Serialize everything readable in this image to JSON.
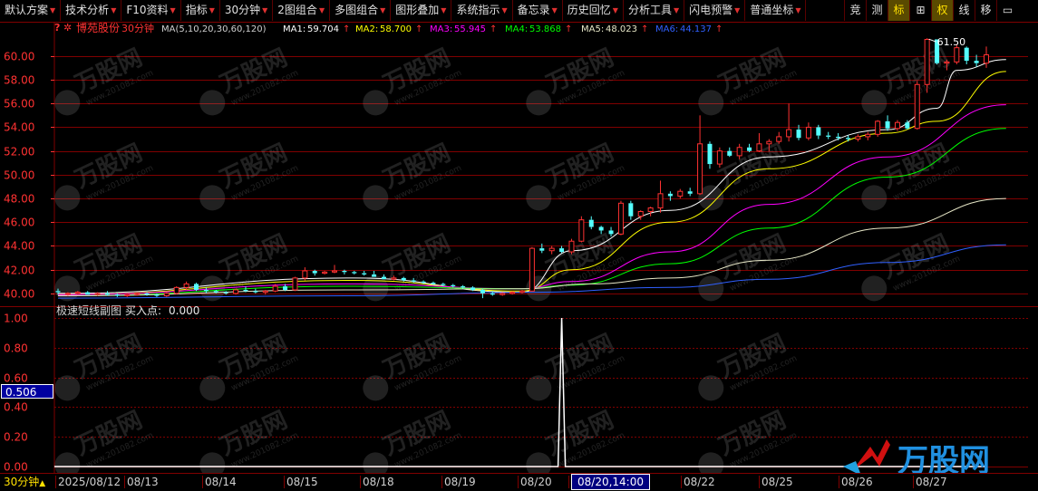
{
  "toolbar": {
    "items": [
      {
        "label": "默认方案",
        "dropdown": true
      },
      {
        "label": "技术分析",
        "dropdown": true
      },
      {
        "label": "F10资料",
        "dropdown": true
      },
      {
        "label": "指标",
        "dropdown": true
      },
      {
        "label": "30分钟",
        "dropdown": true
      },
      {
        "label": "2图组合",
        "dropdown": true
      },
      {
        "label": "多图组合",
        "dropdown": true
      },
      {
        "label": "图形叠加",
        "dropdown": true
      },
      {
        "label": "系统指示",
        "dropdown": true
      },
      {
        "label": "备忘录",
        "dropdown": true
      },
      {
        "label": "历史回忆",
        "dropdown": true
      },
      {
        "label": "分析工具",
        "dropdown": true
      },
      {
        "label": "闪电预警",
        "dropdown": true
      },
      {
        "label": "普通坐标",
        "dropdown": true
      }
    ],
    "right_buttons": [
      "竞",
      "测",
      "标",
      "田",
      "权",
      "线",
      "移",
      "窗"
    ]
  },
  "main": {
    "question_mark": "?",
    "stock_name": "博苑股份",
    "period": "30分钟",
    "ma_spec": "MA(5,10,20,30,60,120)",
    "ma_values": [
      {
        "label": "MA1:",
        "value": "59.704",
        "arrow": "↑",
        "color": "#ffffff"
      },
      {
        "label": "MA2:",
        "value": "58.700",
        "arrow": "↑",
        "color": "#ffff00"
      },
      {
        "label": "MA3:",
        "value": "55.945",
        "arrow": "↑",
        "color": "#ff00ff"
      },
      {
        "label": "MA4:",
        "value": "53.868",
        "arrow": "↑",
        "color": "#00ff00"
      },
      {
        "label": "MA5:",
        "value": "48.023",
        "arrow": "↑",
        "color": "#e8e8c8"
      },
      {
        "label": "MA6:",
        "value": "44.137",
        "arrow": "↑",
        "color": "#3060ff"
      }
    ],
    "high_label": "61.50"
  },
  "sub": {
    "title": "极速短线副图",
    "buy_label": "买入点:",
    "buy_value": "0.000",
    "cursor_value": "0.506"
  },
  "colors": {
    "up": "#ff3232",
    "down": "#54ffff",
    "grid": "#800000",
    "axis_text": "#ff3232"
  },
  "status": {
    "period_label": "30分钟",
    "dates": [
      "2025/08/12",
      "08/13",
      "08/14",
      "08/15",
      "08/18",
      "08/19",
      "08/20",
      "08/20,14:00",
      "08/22",
      "08/25",
      "08/26",
      "08/27"
    ]
  },
  "watermark": {
    "brand": "万股网",
    "url": "www.201082.com"
  },
  "chart_data": [
    {
      "type": "candlestick",
      "title": "博苑股份 30分钟",
      "ylim": [
        39.0,
        62.2
      ],
      "yticks": [
        40,
        42,
        44,
        46,
        48,
        50,
        52,
        54,
        56,
        58,
        60
      ],
      "ytick_labels": [
        "40.00",
        "42.00",
        "44.00",
        "46.00",
        "48.00",
        "50.00",
        "52.00",
        "54.00",
        "56.00",
        "58.00",
        "60.00"
      ],
      "candles": [
        [
          40.2,
          40.4,
          39.9,
          40.1
        ],
        [
          40.0,
          40.1,
          39.8,
          40.0
        ],
        [
          40.0,
          40.2,
          39.9,
          40.1
        ],
        [
          40.1,
          40.2,
          39.9,
          39.9
        ],
        [
          39.9,
          40.1,
          39.8,
          40.0
        ],
        [
          40.0,
          40.2,
          39.8,
          39.9
        ],
        [
          39.9,
          40.0,
          39.7,
          39.8
        ],
        [
          39.8,
          40.0,
          39.7,
          39.9
        ],
        [
          39.9,
          40.1,
          39.8,
          40.0
        ],
        [
          40.0,
          40.1,
          39.8,
          39.9
        ],
        [
          39.9,
          40.0,
          39.7,
          39.8
        ],
        [
          39.8,
          40.1,
          39.7,
          40.0
        ],
        [
          40.0,
          40.6,
          39.9,
          40.5
        ],
        [
          40.5,
          41.0,
          40.3,
          40.8
        ],
        [
          40.8,
          40.9,
          40.2,
          40.3
        ],
        [
          40.3,
          40.5,
          40.0,
          40.2
        ],
        [
          40.2,
          40.3,
          40.0,
          40.1
        ],
        [
          40.1,
          40.2,
          39.9,
          40.0
        ],
        [
          40.0,
          40.4,
          39.9,
          40.3
        ],
        [
          40.3,
          40.6,
          40.1,
          40.2
        ],
        [
          40.2,
          40.4,
          40.0,
          40.1
        ],
        [
          40.1,
          40.3,
          39.9,
          40.2
        ],
        [
          40.2,
          40.8,
          40.1,
          40.6
        ],
        [
          40.6,
          40.8,
          40.2,
          40.3
        ],
        [
          40.3,
          41.4,
          40.2,
          41.3
        ],
        [
          41.3,
          42.2,
          41.1,
          41.9
        ],
        [
          41.9,
          42.0,
          41.5,
          41.7
        ],
        [
          41.7,
          41.9,
          41.6,
          41.8
        ],
        [
          41.8,
          42.4,
          41.7,
          41.9
        ],
        [
          41.9,
          42.0,
          41.6,
          41.8
        ],
        [
          41.8,
          41.9,
          41.6,
          41.7
        ],
        [
          41.7,
          41.9,
          41.5,
          41.6
        ],
        [
          41.6,
          41.9,
          41.4,
          41.4
        ],
        [
          41.4,
          41.6,
          41.2,
          41.2
        ],
        [
          41.2,
          41.5,
          41.1,
          41.3
        ],
        [
          41.3,
          41.4,
          41.0,
          41.1
        ],
        [
          41.1,
          41.3,
          40.9,
          41.0
        ],
        [
          41.0,
          41.1,
          40.8,
          40.9
        ],
        [
          40.9,
          41.0,
          40.7,
          40.8
        ],
        [
          40.8,
          40.9,
          40.6,
          40.7
        ],
        [
          40.7,
          40.8,
          40.5,
          40.6
        ],
        [
          40.6,
          40.7,
          40.4,
          40.5
        ],
        [
          40.5,
          40.6,
          40.2,
          40.3
        ],
        [
          40.3,
          40.4,
          39.6,
          40.0
        ],
        [
          40.0,
          40.2,
          39.8,
          39.9
        ],
        [
          39.9,
          40.1,
          39.8,
          40.0
        ],
        [
          40.0,
          40.2,
          39.9,
          40.1
        ],
        [
          40.1,
          40.3,
          40.0,
          40.2
        ],
        [
          40.2,
          43.9,
          40.2,
          43.8
        ],
        [
          43.8,
          44.2,
          43.4,
          43.6
        ],
        [
          43.6,
          44.0,
          43.3,
          43.8
        ],
        [
          43.8,
          44.0,
          43.4,
          43.5
        ],
        [
          43.5,
          44.6,
          43.3,
          44.4
        ],
        [
          44.4,
          46.5,
          44.3,
          46.2
        ],
        [
          46.2,
          46.5,
          45.4,
          45.6
        ],
        [
          45.6,
          45.7,
          45.0,
          45.3
        ],
        [
          45.3,
          45.6,
          44.8,
          45.0
        ],
        [
          45.0,
          47.8,
          44.9,
          47.6
        ],
        [
          47.6,
          47.8,
          46.2,
          46.5
        ],
        [
          46.5,
          47.0,
          46.2,
          46.9
        ],
        [
          46.9,
          47.3,
          46.5,
          47.2
        ],
        [
          47.2,
          49.5,
          46.8,
          48.4
        ],
        [
          48.4,
          48.6,
          47.8,
          48.2
        ],
        [
          48.2,
          48.8,
          48.0,
          48.6
        ],
        [
          48.6,
          48.9,
          48.2,
          48.4
        ],
        [
          48.4,
          55.0,
          48.3,
          52.6
        ],
        [
          52.6,
          52.8,
          50.5,
          50.9
        ],
        [
          50.9,
          52.3,
          50.6,
          52.0
        ],
        [
          52.0,
          52.3,
          51.5,
          51.6
        ],
        [
          51.6,
          52.6,
          51.3,
          52.3
        ],
        [
          52.3,
          52.6,
          51.9,
          52.0
        ],
        [
          52.0,
          53.5,
          51.9,
          52.6
        ],
        [
          52.6,
          53.0,
          52.0,
          52.8
        ],
        [
          52.8,
          53.6,
          52.6,
          53.2
        ],
        [
          53.2,
          56.0,
          52.8,
          53.8
        ],
        [
          53.8,
          54.2,
          52.9,
          53.1
        ],
        [
          53.1,
          54.4,
          52.9,
          54.0
        ],
        [
          54.0,
          54.2,
          53.0,
          53.3
        ],
        [
          53.3,
          53.6,
          53.0,
          53.2
        ],
        [
          53.2,
          53.5,
          52.9,
          53.1
        ],
        [
          53.1,
          53.3,
          52.8,
          53.0
        ],
        [
          53.0,
          53.4,
          52.8,
          53.2
        ],
        [
          53.2,
          53.6,
          52.9,
          53.4
        ],
        [
          53.4,
          54.6,
          53.2,
          54.5
        ],
        [
          54.5,
          55.0,
          53.7,
          53.9
        ],
        [
          53.9,
          54.6,
          53.7,
          54.4
        ],
        [
          54.4,
          54.6,
          53.8,
          53.9
        ],
        [
          53.9,
          57.9,
          53.8,
          57.6
        ],
        [
          57.6,
          61.5,
          56.9,
          61.4
        ],
        [
          61.4,
          61.4,
          59.3,
          59.4
        ],
        [
          59.4,
          59.7,
          58.8,
          59.5
        ],
        [
          59.5,
          61.0,
          59.3,
          60.7
        ],
        [
          60.7,
          60.8,
          59.3,
          59.6
        ],
        [
          59.6,
          60.1,
          59.1,
          59.4
        ],
        [
          59.4,
          60.8,
          59.0,
          60.1
        ]
      ],
      "ma_series": [
        {
          "name": "MA1",
          "color": "#ffffff",
          "points": [
            [
              0,
              40.0
            ],
            [
              30,
              41.3
            ],
            [
              47,
              40.1
            ],
            [
              52,
              43.6
            ],
            [
              62,
              47.0
            ],
            [
              72,
              51.5
            ],
            [
              84,
              53.8
            ],
            [
              89,
              55.6
            ],
            [
              91,
              58.8
            ],
            [
              96,
              59.7
            ]
          ]
        },
        {
          "name": "MA2",
          "color": "#ffff00",
          "points": [
            [
              0,
              39.9
            ],
            [
              30,
              41.1
            ],
            [
              47,
              40.2
            ],
            [
              52,
              42.0
            ],
            [
              62,
              46.0
            ],
            [
              72,
              50.5
            ],
            [
              84,
              53.5
            ],
            [
              89,
              54.5
            ],
            [
              96,
              58.7
            ]
          ]
        },
        {
          "name": "MA3",
          "color": "#ff00ff",
          "points": [
            [
              0,
              39.9
            ],
            [
              30,
              40.8
            ],
            [
              47,
              40.4
            ],
            [
              52,
              41.0
            ],
            [
              62,
              43.5
            ],
            [
              72,
              47.5
            ],
            [
              84,
              51.5
            ],
            [
              96,
              55.9
            ]
          ]
        },
        {
          "name": "MA4",
          "color": "#00ff00",
          "points": [
            [
              0,
              39.8
            ],
            [
              30,
              40.6
            ],
            [
              47,
              40.4
            ],
            [
              52,
              40.7
            ],
            [
              62,
              42.5
            ],
            [
              72,
              45.5
            ],
            [
              84,
              49.8
            ],
            [
              96,
              53.9
            ]
          ]
        },
        {
          "name": "MA5",
          "color": "#e8e8c8",
          "points": [
            [
              0,
              39.8
            ],
            [
              30,
              40.3
            ],
            [
              47,
              40.4
            ],
            [
              54,
              40.8
            ],
            [
              62,
              41.3
            ],
            [
              72,
              42.8
            ],
            [
              84,
              45.5
            ],
            [
              96,
              48.0
            ]
          ]
        },
        {
          "name": "MA6",
          "color": "#3060ff",
          "points": [
            [
              0,
              39.6
            ],
            [
              30,
              39.8
            ],
            [
              48,
              40.1
            ],
            [
              62,
              40.5
            ],
            [
              72,
              41.2
            ],
            [
              84,
              42.6
            ],
            [
              96,
              44.1
            ]
          ]
        }
      ]
    },
    {
      "type": "line",
      "title": "极速短线副图",
      "ylim": [
        0.0,
        1.0
      ],
      "yticks": [
        0.0,
        0.2,
        0.4,
        0.6,
        0.8,
        1.0
      ],
      "ytick_labels": [
        "0.00",
        "0.20",
        "0.40",
        "0.60",
        "0.80",
        "1.00"
      ],
      "series": [
        {
          "name": "买入点",
          "color": "#ffffff",
          "spike_at": 51,
          "values": "0 except 1.0 at index 51"
        }
      ]
    }
  ]
}
